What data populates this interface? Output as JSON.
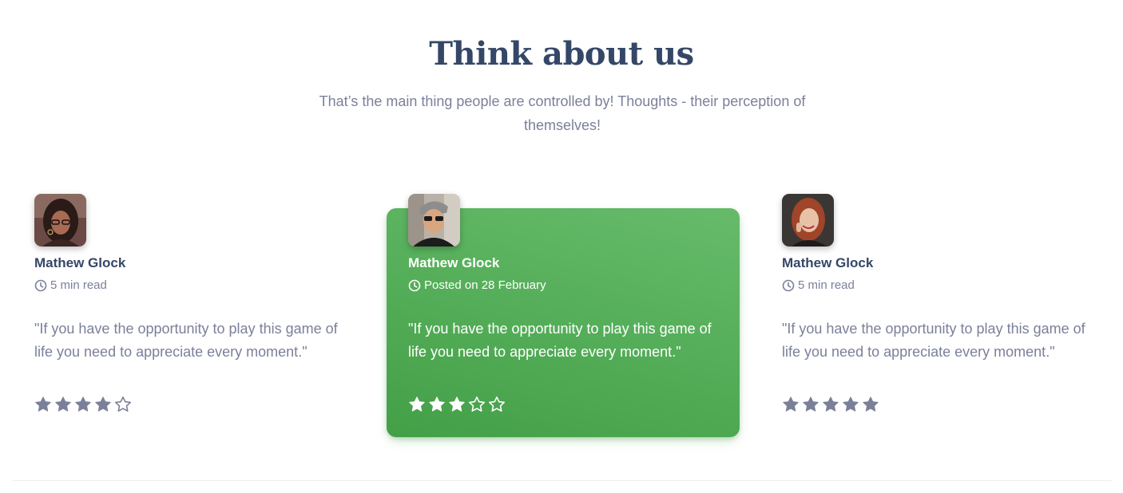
{
  "header": {
    "title": "Think about us",
    "subtitle": "That’s the main thing people are controlled by! Thoughts - their perception of themselves!"
  },
  "colors": {
    "heading": "#344767",
    "muted": "#7b809a",
    "accent_green_light": "#66bb6a",
    "accent_green_dark": "#43a047",
    "star": "#7b809a"
  },
  "testimonials": [
    {
      "name": "Mathew Glock",
      "meta_icon": "clock-icon",
      "meta": "5 min read",
      "quote": "\"If you have the opportunity to play this game of life you need to appreciate every moment.\"",
      "rating": 4,
      "max_rating": 5,
      "highlighted": false
    },
    {
      "name": "Mathew Glock",
      "meta_icon": "clock-icon",
      "meta": "Posted on 28 February",
      "quote": "\"If you have the opportunity to play this game of life you need to appreciate every moment.\"",
      "rating": 3,
      "max_rating": 5,
      "highlighted": true
    },
    {
      "name": "Mathew Glock",
      "meta_icon": "clock-icon",
      "meta": "5 min read",
      "quote": "\"If you have the opportunity to play this game of life you need to appreciate every moment.\"",
      "rating": 5,
      "max_rating": 5,
      "highlighted": false
    }
  ]
}
